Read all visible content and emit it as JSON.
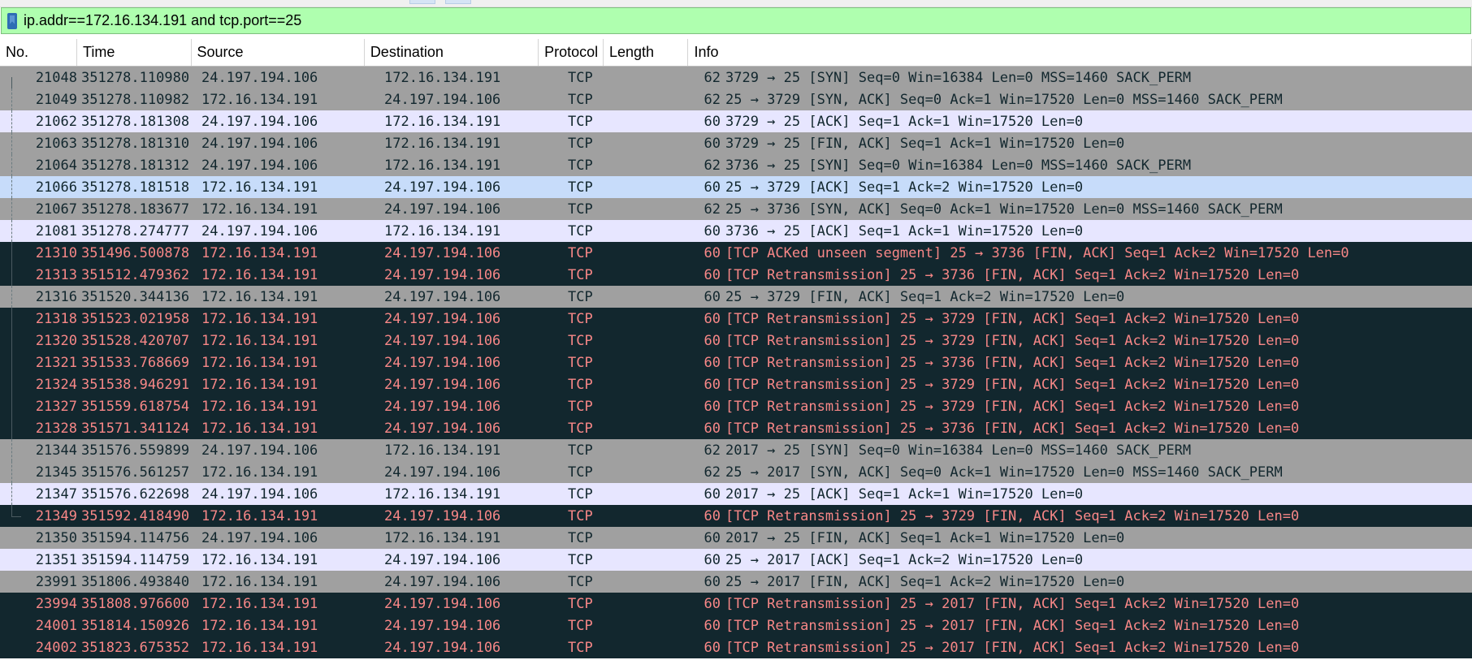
{
  "filter": {
    "text": "ip.addr==172.16.134.191 and tcp.port==25"
  },
  "columns": [
    {
      "key": "no",
      "label": "No.",
      "width": 100
    },
    {
      "key": "time",
      "label": "Time",
      "width": 148
    },
    {
      "key": "src",
      "label": "Source",
      "width": 225
    },
    {
      "key": "dst",
      "label": "Destination",
      "width": 226
    },
    {
      "key": "proto",
      "label": "Protocol",
      "width": 84
    },
    {
      "key": "len",
      "label": "Length",
      "width": 110
    },
    {
      "key": "info",
      "label": "Info",
      "width": 1019
    }
  ],
  "colors": {
    "filter_bg": "#afffaf",
    "gray_row": "#a0a0a0",
    "lavender_row": "#e7e6ff",
    "blue_row": "#c7dcfa",
    "dark_row": "#12272e",
    "dark_row_text": "#f78787"
  },
  "packets": [
    {
      "no": "21048",
      "time": "351278.110980",
      "src": "24.197.194.106",
      "dst": "172.16.134.191",
      "proto": "TCP",
      "len": "62",
      "info": "3729 → 25 [SYN] Seq=0 Win=16384 Len=0 MSS=1460 SACK_PERM",
      "style": "gray"
    },
    {
      "no": "21049",
      "time": "351278.110982",
      "src": "172.16.134.191",
      "dst": "24.197.194.106",
      "proto": "TCP",
      "len": "62",
      "info": "25 → 3729 [SYN, ACK] Seq=0 Ack=1 Win=17520 Len=0 MSS=1460 SACK_PERM",
      "style": "gray"
    },
    {
      "no": "21062",
      "time": "351278.181308",
      "src": "24.197.194.106",
      "dst": "172.16.134.191",
      "proto": "TCP",
      "len": "60",
      "info": "3729 → 25 [ACK] Seq=1 Ack=1 Win=17520 Len=0",
      "style": "lav"
    },
    {
      "no": "21063",
      "time": "351278.181310",
      "src": "24.197.194.106",
      "dst": "172.16.134.191",
      "proto": "TCP",
      "len": "60",
      "info": "3729 → 25 [FIN, ACK] Seq=1 Ack=1 Win=17520 Len=0",
      "style": "gray"
    },
    {
      "no": "21064",
      "time": "351278.181312",
      "src": "24.197.194.106",
      "dst": "172.16.134.191",
      "proto": "TCP",
      "len": "62",
      "info": "3736 → 25 [SYN] Seq=0 Win=16384 Len=0 MSS=1460 SACK_PERM",
      "style": "gray"
    },
    {
      "no": "21066",
      "time": "351278.181518",
      "src": "172.16.134.191",
      "dst": "24.197.194.106",
      "proto": "TCP",
      "len": "60",
      "info": "25 → 3729 [ACK] Seq=1 Ack=2 Win=17520 Len=0",
      "style": "blue"
    },
    {
      "no": "21067",
      "time": "351278.183677",
      "src": "172.16.134.191",
      "dst": "24.197.194.106",
      "proto": "TCP",
      "len": "62",
      "info": "25 → 3736 [SYN, ACK] Seq=0 Ack=1 Win=17520 Len=0 MSS=1460 SACK_PERM",
      "style": "gray"
    },
    {
      "no": "21081",
      "time": "351278.274777",
      "src": "24.197.194.106",
      "dst": "172.16.134.191",
      "proto": "TCP",
      "len": "60",
      "info": "3736 → 25 [ACK] Seq=1 Ack=1 Win=17520 Len=0",
      "style": "lav"
    },
    {
      "no": "21310",
      "time": "351496.500878",
      "src": "172.16.134.191",
      "dst": "24.197.194.106",
      "proto": "TCP",
      "len": "60",
      "info": "[TCP ACKed unseen segment] 25 → 3736 [FIN, ACK] Seq=1 Ack=2 Win=17520 Len=0",
      "style": "dark"
    },
    {
      "no": "21313",
      "time": "351512.479362",
      "src": "172.16.134.191",
      "dst": "24.197.194.106",
      "proto": "TCP",
      "len": "60",
      "info": "[TCP Retransmission] 25 → 3736 [FIN, ACK] Seq=1 Ack=2 Win=17520 Len=0",
      "style": "dark"
    },
    {
      "no": "21316",
      "time": "351520.344136",
      "src": "172.16.134.191",
      "dst": "24.197.194.106",
      "proto": "TCP",
      "len": "60",
      "info": "25 → 3729 [FIN, ACK] Seq=1 Ack=2 Win=17520 Len=0",
      "style": "gray"
    },
    {
      "no": "21318",
      "time": "351523.021958",
      "src": "172.16.134.191",
      "dst": "24.197.194.106",
      "proto": "TCP",
      "len": "60",
      "info": "[TCP Retransmission] 25 → 3729 [FIN, ACK] Seq=1 Ack=2 Win=17520 Len=0",
      "style": "dark"
    },
    {
      "no": "21320",
      "time": "351528.420707",
      "src": "172.16.134.191",
      "dst": "24.197.194.106",
      "proto": "TCP",
      "len": "60",
      "info": "[TCP Retransmission] 25 → 3729 [FIN, ACK] Seq=1 Ack=2 Win=17520 Len=0",
      "style": "dark"
    },
    {
      "no": "21321",
      "time": "351533.768669",
      "src": "172.16.134.191",
      "dst": "24.197.194.106",
      "proto": "TCP",
      "len": "60",
      "info": "[TCP Retransmission] 25 → 3736 [FIN, ACK] Seq=1 Ack=2 Win=17520 Len=0",
      "style": "dark"
    },
    {
      "no": "21324",
      "time": "351538.946291",
      "src": "172.16.134.191",
      "dst": "24.197.194.106",
      "proto": "TCP",
      "len": "60",
      "info": "[TCP Retransmission] 25 → 3729 [FIN, ACK] Seq=1 Ack=2 Win=17520 Len=0",
      "style": "dark"
    },
    {
      "no": "21327",
      "time": "351559.618754",
      "src": "172.16.134.191",
      "dst": "24.197.194.106",
      "proto": "TCP",
      "len": "60",
      "info": "[TCP Retransmission] 25 → 3729 [FIN, ACK] Seq=1 Ack=2 Win=17520 Len=0",
      "style": "dark"
    },
    {
      "no": "21328",
      "time": "351571.341124",
      "src": "172.16.134.191",
      "dst": "24.197.194.106",
      "proto": "TCP",
      "len": "60",
      "info": "[TCP Retransmission] 25 → 3736 [FIN, ACK] Seq=1 Ack=2 Win=17520 Len=0",
      "style": "dark"
    },
    {
      "no": "21344",
      "time": "351576.559899",
      "src": "24.197.194.106",
      "dst": "172.16.134.191",
      "proto": "TCP",
      "len": "62",
      "info": "2017 → 25 [SYN] Seq=0 Win=16384 Len=0 MSS=1460 SACK_PERM",
      "style": "gray"
    },
    {
      "no": "21345",
      "time": "351576.561257",
      "src": "172.16.134.191",
      "dst": "24.197.194.106",
      "proto": "TCP",
      "len": "62",
      "info": "25 → 2017 [SYN, ACK] Seq=0 Ack=1 Win=17520 Len=0 MSS=1460 SACK_PERM",
      "style": "gray"
    },
    {
      "no": "21347",
      "time": "351576.622698",
      "src": "24.197.194.106",
      "dst": "172.16.134.191",
      "proto": "TCP",
      "len": "60",
      "info": "2017 → 25 [ACK] Seq=1 Ack=1 Win=17520 Len=0",
      "style": "lav"
    },
    {
      "no": "21349",
      "time": "351592.418490",
      "src": "172.16.134.191",
      "dst": "24.197.194.106",
      "proto": "TCP",
      "len": "60",
      "info": "[TCP Retransmission] 25 → 3729 [FIN, ACK] Seq=1 Ack=2 Win=17520 Len=0",
      "style": "dark"
    },
    {
      "no": "21350",
      "time": "351594.114756",
      "src": "24.197.194.106",
      "dst": "172.16.134.191",
      "proto": "TCP",
      "len": "60",
      "info": "2017 → 25 [FIN, ACK] Seq=1 Ack=1 Win=17520 Len=0",
      "style": "gray"
    },
    {
      "no": "21351",
      "time": "351594.114759",
      "src": "172.16.134.191",
      "dst": "24.197.194.106",
      "proto": "TCP",
      "len": "60",
      "info": "25 → 2017 [ACK] Seq=1 Ack=2 Win=17520 Len=0",
      "style": "lav"
    },
    {
      "no": "23991",
      "time": "351806.493840",
      "src": "172.16.134.191",
      "dst": "24.197.194.106",
      "proto": "TCP",
      "len": "60",
      "info": "25 → 2017 [FIN, ACK] Seq=1 Ack=2 Win=17520 Len=0",
      "style": "gray"
    },
    {
      "no": "23994",
      "time": "351808.976600",
      "src": "172.16.134.191",
      "dst": "24.197.194.106",
      "proto": "TCP",
      "len": "60",
      "info": "[TCP Retransmission] 25 → 2017 [FIN, ACK] Seq=1 Ack=2 Win=17520 Len=0",
      "style": "dark"
    },
    {
      "no": "24001",
      "time": "351814.150926",
      "src": "172.16.134.191",
      "dst": "24.197.194.106",
      "proto": "TCP",
      "len": "60",
      "info": "[TCP Retransmission] 25 → 2017 [FIN, ACK] Seq=1 Ack=2 Win=17520 Len=0",
      "style": "dark"
    },
    {
      "no": "24002",
      "time": "351823.675352",
      "src": "172.16.134.191",
      "dst": "24.197.194.106",
      "proto": "TCP",
      "len": "60",
      "info": "[TCP Retransmission] 25 → 2017 [FIN, ACK] Seq=1 Ack=2 Win=17520 Len=0",
      "style": "dark"
    }
  ]
}
